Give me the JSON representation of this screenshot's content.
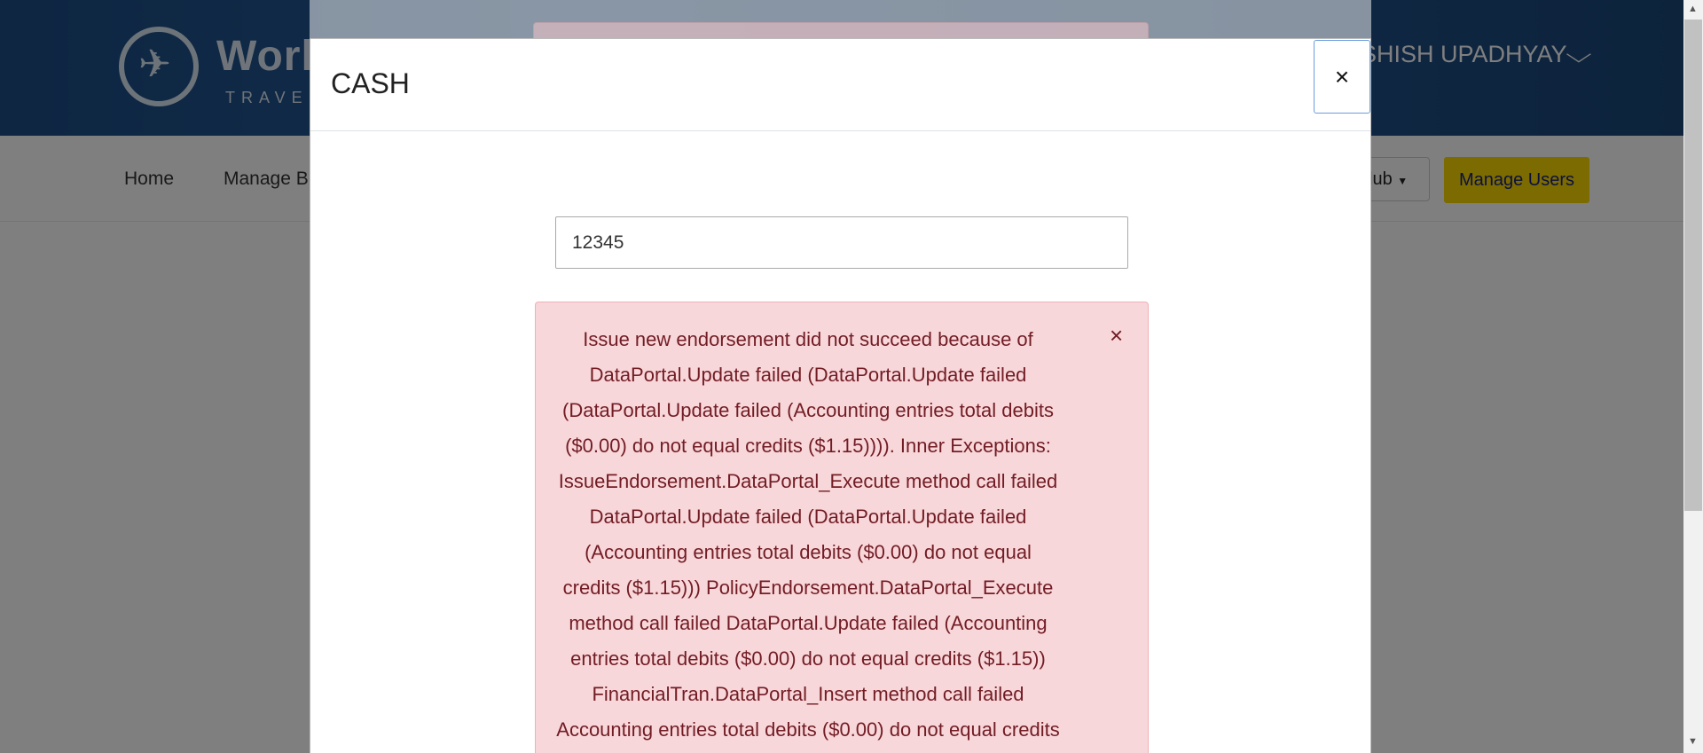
{
  "header": {
    "brand": "Worl",
    "brand_sub": "TRAVEL",
    "user_name": "SHISH UPADHYAY",
    "plane_icon": "airplane-icon"
  },
  "nav": {
    "home": "Home",
    "manage": "Manage B",
    "club": "lub",
    "manage_users": "Manage Users"
  },
  "modal": {
    "title": "CASH",
    "close_label": "×",
    "amount_value": "12345",
    "alert": {
      "message": "Issue new endorsement did not succeed because of DataPortal.Update failed (DataPortal.Update failed (DataPortal.Update failed (Accounting entries total debits ($0.00) do not equal credits ($1.15)))). Inner Exceptions: IssueEndorsement.DataPortal_Execute method call failed DataPortal.Update failed (DataPortal.Update failed (Accounting entries total debits ($0.00) do not equal credits ($1.15))) PolicyEndorsement.DataPortal_Execute method call failed DataPortal.Update failed (Accounting entries total debits ($0.00) do not equal credits ($1.15)) FinancialTran.DataPortal_Insert method call failed Accounting entries total debits ($0.00) do not equal credits",
      "close_label": "×"
    }
  },
  "colors": {
    "header_bg": "#1d4e86",
    "alert_bg": "#f8d7da",
    "alert_text": "#721c24",
    "manage_users_bg": "#f6d600"
  }
}
